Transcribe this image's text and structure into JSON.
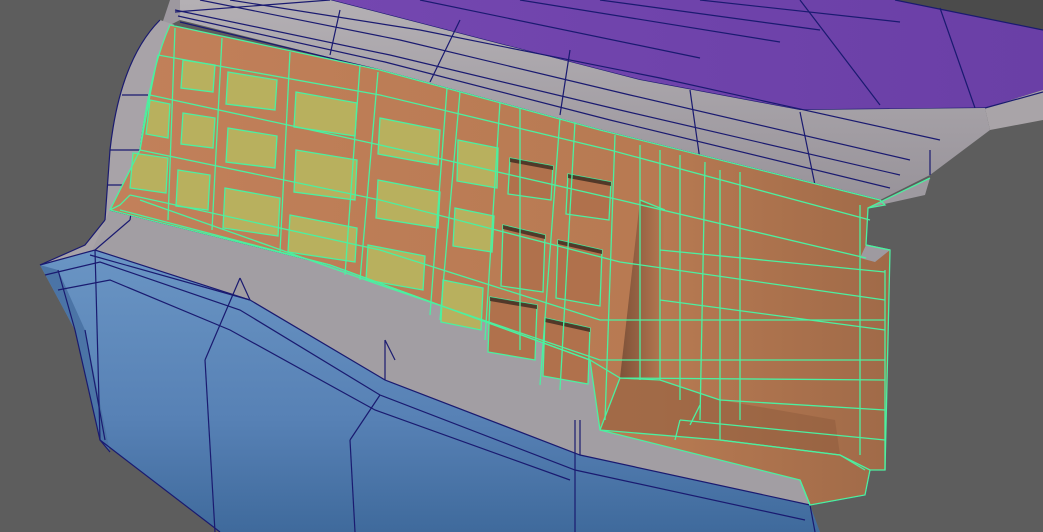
{
  "viewport": {
    "background_color": "#5d5d5d",
    "wire_color": "#17176b",
    "selected_wire_color": "#4cf0a0"
  },
  "materials": {
    "roof": "#6b3fa5",
    "trim": "#a9a4a8",
    "panel": "#b97a55",
    "lamp_lens": "#b9b060",
    "bumper": "#5a86b8"
  }
}
